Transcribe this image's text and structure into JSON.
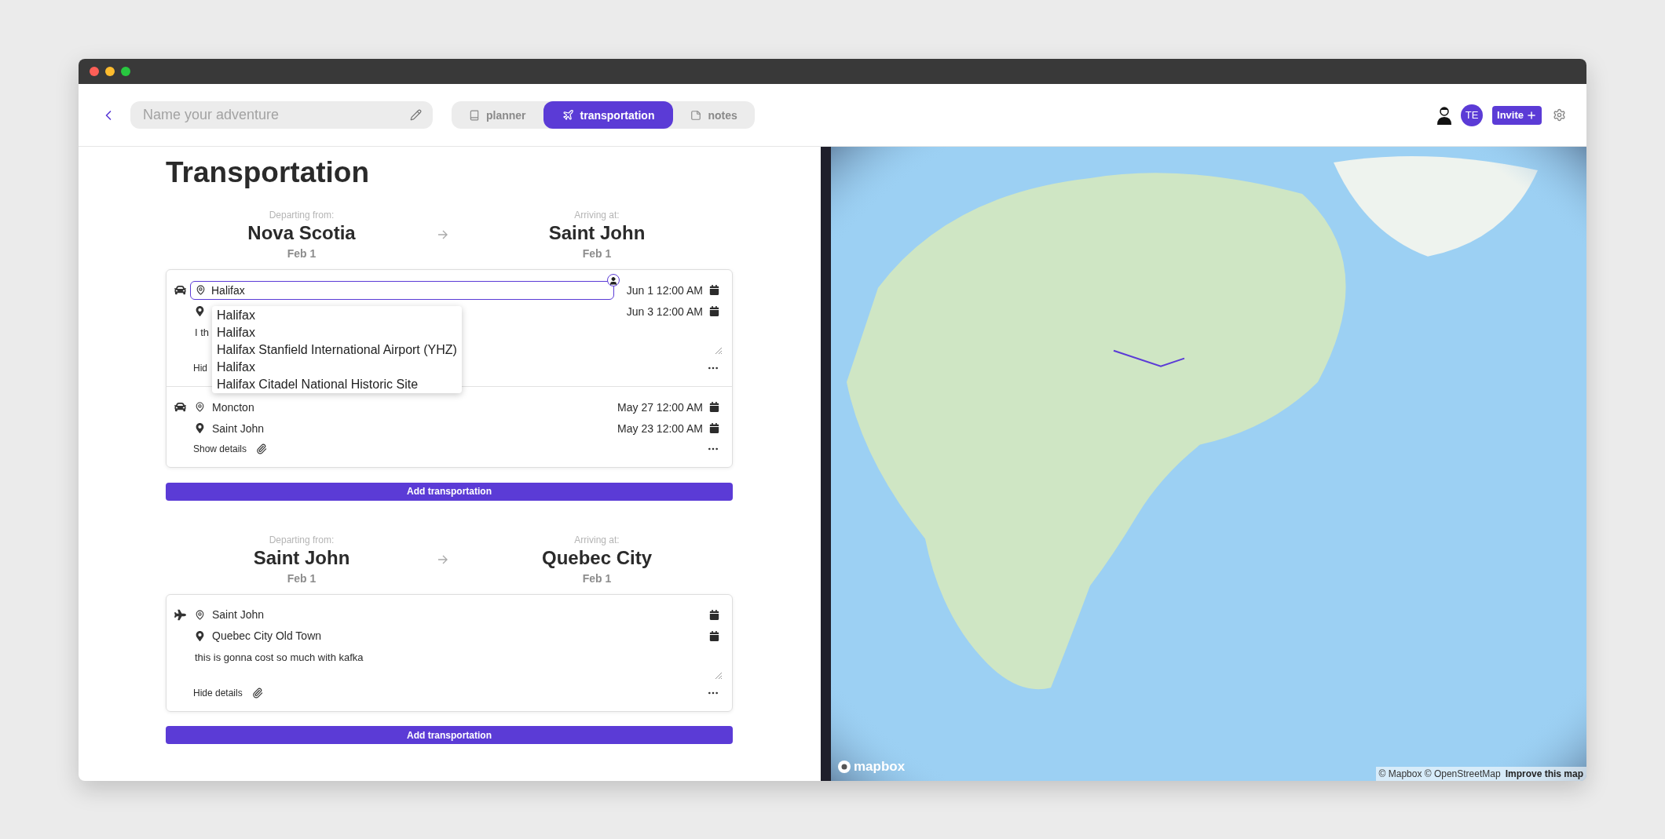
{
  "header": {
    "name_field": {
      "placeholder": "Name your adventure"
    },
    "tabs": [
      {
        "label": "planner",
        "selected": false
      },
      {
        "label": "transportation",
        "selected": true
      },
      {
        "label": "notes",
        "selected": false
      }
    ],
    "avatar_initials": "TE",
    "invite_button": "Invite"
  },
  "title": "Transportation",
  "legs": [
    {
      "from_label": "Departing from:",
      "from": "Nova Scotia",
      "from_date": "Feb 1",
      "to_label": "Arriving at:",
      "to": "Saint John",
      "to_date": "Feb 1",
      "transports": [
        {
          "kind": "car",
          "origin": "Halifax",
          "origin_active": true,
          "depart_time": "Jun 1 12:00 AM",
          "arrive_time": "Jun 3 12:00 AM",
          "details_open": true,
          "notes": "I th",
          "details_toggle": "Hid",
          "suggestions": [
            "Halifax",
            "Halifax",
            "Halifax Stanfield International Airport (YHZ)",
            "Halifax",
            "Halifax Citadel National Historic Site"
          ]
        },
        {
          "kind": "car",
          "origin": "Moncton",
          "origin_active": false,
          "destination": "Saint John",
          "depart_time": "May 27 12:00 AM",
          "arrive_time": "May 23 12:00 AM",
          "details_open": false,
          "details_toggle": "Show details"
        }
      ],
      "add_button": "Add transportation"
    },
    {
      "from_label": "Departing from:",
      "from": "Saint John",
      "from_date": "Feb 1",
      "to_label": "Arriving at:",
      "to": "Quebec City",
      "to_date": "Feb 1",
      "transports": [
        {
          "kind": "plane",
          "origin": "Saint John",
          "origin_active": false,
          "destination": "Quebec City Old Town",
          "details_open": true,
          "notes": "this is gonna cost so much with kafka",
          "details_toggle": "Hide details"
        }
      ],
      "add_button": "Add transportation"
    }
  ],
  "map": {
    "logo": "mapbox",
    "attribution": "© Mapbox © OpenStreetMap",
    "improve_link": "Improve this map"
  }
}
